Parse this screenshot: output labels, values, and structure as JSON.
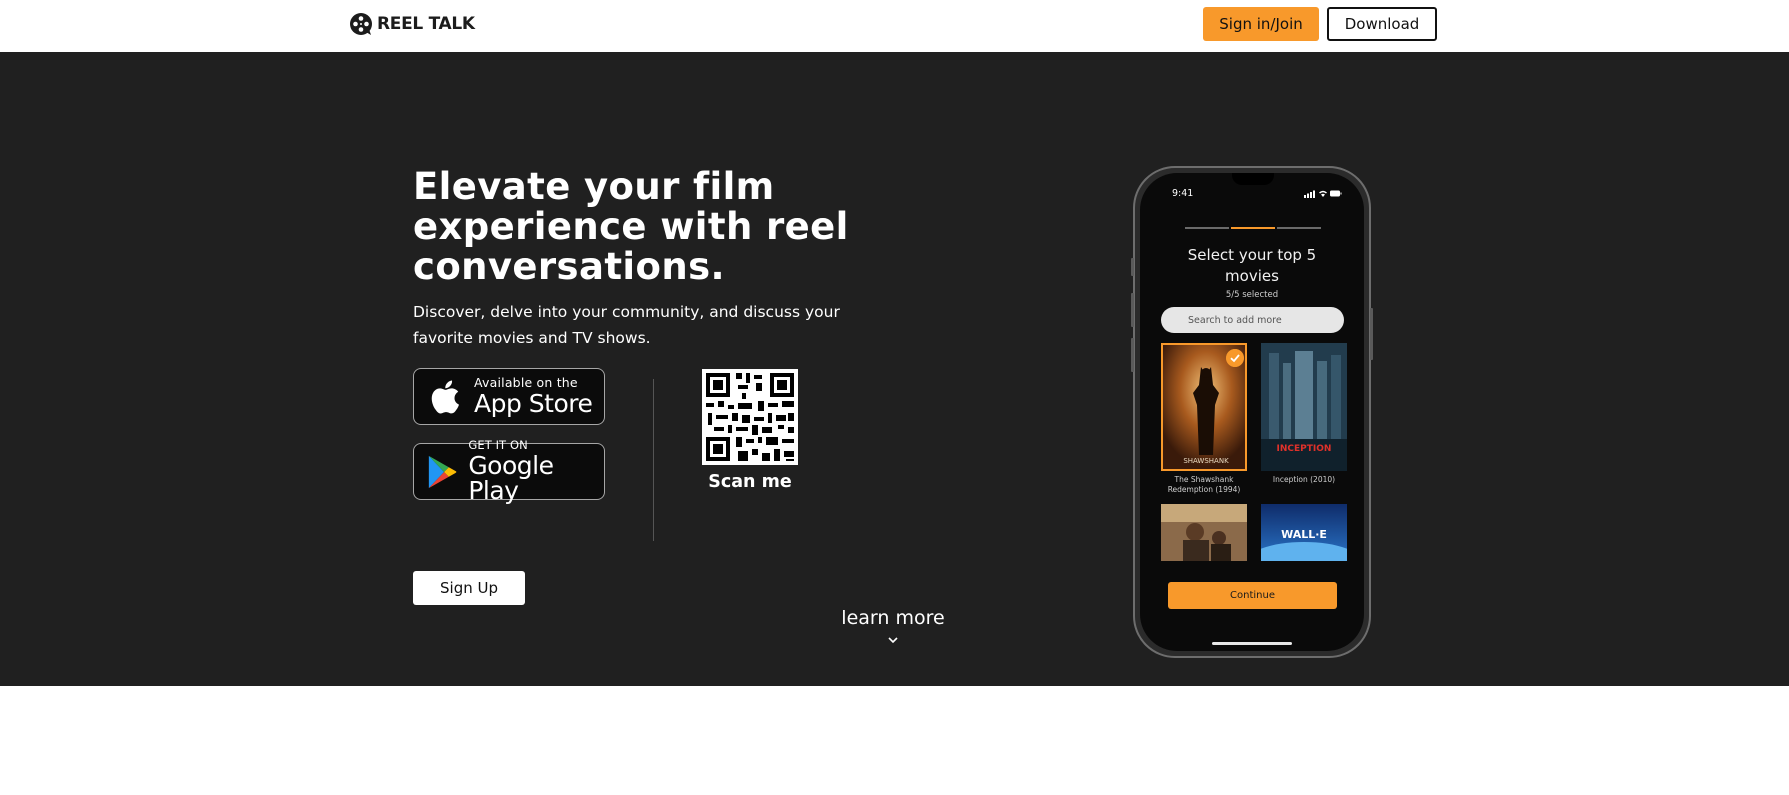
{
  "header": {
    "logo_text": "REEL TALK",
    "signin_label": "Sign in/Join",
    "download_label": "Download"
  },
  "hero": {
    "headline": "Elevate your film experience with reel conversations.",
    "subhead": "Discover, delve into your community, and discuss your favorite movies and TV shows.",
    "app_store": {
      "small": "Available on the",
      "big": "App Store"
    },
    "google_play": {
      "small": "GET IT ON",
      "big": "Google Play"
    },
    "scan_label": "Scan me",
    "signup_label": "Sign Up",
    "learn_more": "learn more"
  },
  "phone": {
    "time": "9:41",
    "title": "Select your top 5 movies",
    "subtitle": "5/5 selected",
    "search_placeholder": "Search to add more",
    "movies": [
      {
        "label": "The Shawshank Redemption (1994)",
        "poster_text": "SHAWSHANK",
        "selected": true
      },
      {
        "label": "Inception (2010)",
        "poster_text": "INCEPTION",
        "selected": false
      },
      {
        "label": "",
        "poster_text": "",
        "selected": false
      },
      {
        "label": "",
        "poster_text": "WALL·E",
        "selected": false
      }
    ],
    "continue_label": "Continue"
  },
  "colors": {
    "accent": "#f8992b",
    "hero_bg": "#202020",
    "header_bg": "#ffffff"
  }
}
